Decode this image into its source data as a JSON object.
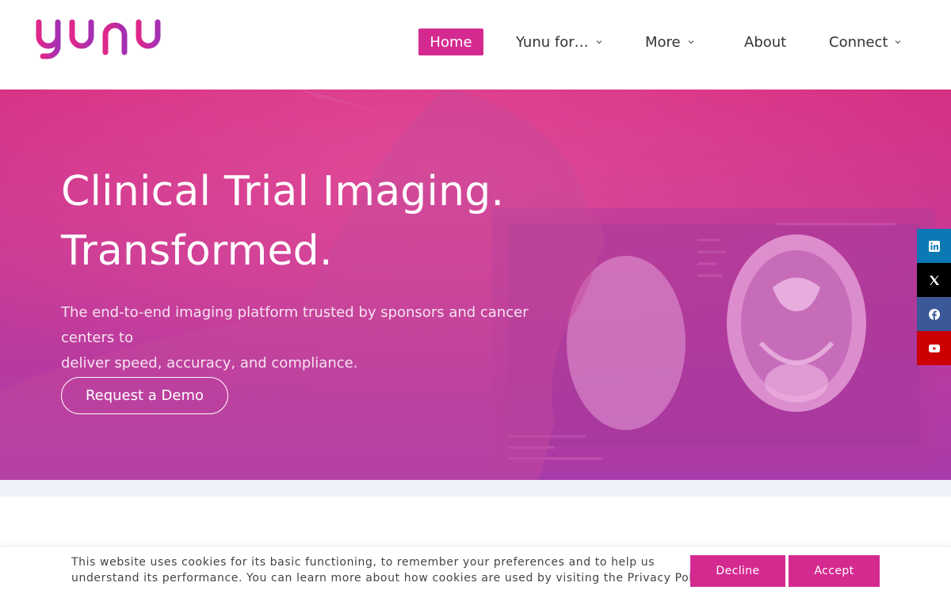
{
  "brand": {
    "name": "yunu",
    "accent": "#d42a90",
    "logo_gradient": [
      "#e0288a",
      "#a52fb3"
    ]
  },
  "nav": {
    "home": "Home",
    "yunu_for": "Yunu for…",
    "more": "More",
    "about": "About",
    "connect": "Connect"
  },
  "hero": {
    "title_line1": "Clinical Trial Imaging.",
    "title_line2": "Transformed.",
    "subtitle_line1": "The end-to-end imaging platform trusted by sponsors and cancer centers to",
    "subtitle_line2": "deliver speed, accuracy, and compliance.",
    "cta": "Request a Demo"
  },
  "social": {
    "items": [
      {
        "icon": "linkedin-icon",
        "color": "#0a79b4"
      },
      {
        "icon": "x-icon",
        "color": "#000000"
      },
      {
        "icon": "facebook-icon",
        "color": "#3b5998"
      },
      {
        "icon": "youtube-icon",
        "color": "#cc0000"
      }
    ]
  },
  "cookie": {
    "text_line1": "This website uses cookies for its basic functioning, to remember your preferences and to help us",
    "text_line2": "understand its performance. You can learn more about how cookies are used by visiting the Privacy Policy",
    "decline": "Decline",
    "accept": "Accept"
  }
}
